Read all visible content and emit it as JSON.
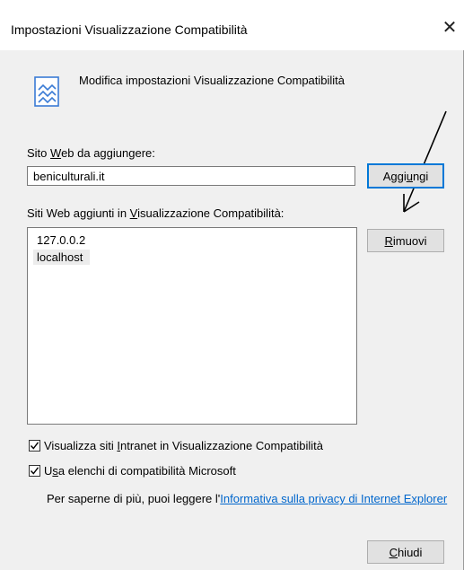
{
  "window": {
    "title": "Impostazioni Visualizzazione Compatibilità",
    "close_glyph": "✕"
  },
  "header": {
    "icon": "compatibility-view-icon",
    "text": "Modifica impostazioni Visualizzazione Compatibilità"
  },
  "add_site": {
    "label": {
      "before": "Sito ",
      "mnemonic": "W",
      "after": "eb da aggiungere:"
    },
    "value": "beniculturali.it",
    "button": {
      "before": "Aggi",
      "mnemonic": "u",
      "after": "ngi"
    }
  },
  "sites_list": {
    "label": {
      "before": "Siti Web aggiunti in ",
      "mnemonic": "V",
      "after": "isualizzazione Compatibilità:"
    },
    "items": [
      {
        "label": "127.0.0.2",
        "selected": false
      },
      {
        "label": "localhost",
        "selected": true
      }
    ]
  },
  "remove_button": {
    "before": "",
    "mnemonic": "R",
    "after": "imuovi"
  },
  "options": {
    "intranet": {
      "checked": true,
      "label": {
        "before": "Visualizza siti ",
        "mnemonic": "I",
        "after": "ntranet in Visualizzazione Compatibilità"
      }
    },
    "microsoft_lists": {
      "checked": true,
      "label": {
        "before": "U",
        "mnemonic": "s",
        "after": "a elenchi di compatibilità Microsoft"
      }
    }
  },
  "info": {
    "text": "Per saperne di più, puoi leggere l'",
    "link": "Informativa sulla privacy di Internet Explorer"
  },
  "close_button": {
    "before": "",
    "mnemonic": "C",
    "after": "hiudi"
  },
  "colors": {
    "dialog_background": "#f0f0f0",
    "accent": "#0078d7",
    "link": "#0066cc"
  }
}
